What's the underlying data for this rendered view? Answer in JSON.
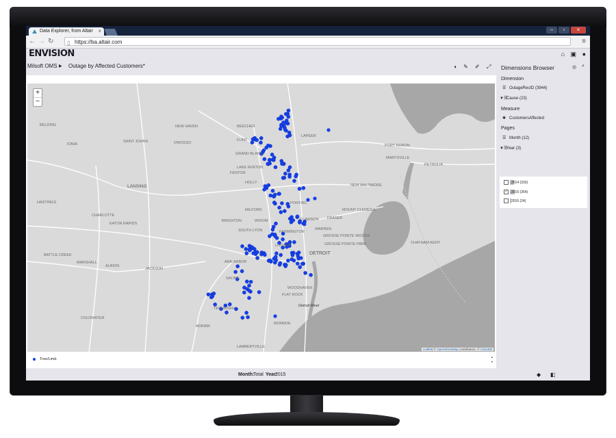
{
  "browser": {
    "tab_title": "Data Explorer, from Altair",
    "url": "https://ba.altair.com"
  },
  "app": {
    "logo": "ENVISION",
    "breadcrumb": [
      "Milsoft OMS",
      "Outage by Affected Customers*"
    ]
  },
  "map": {
    "zoom_in": "+",
    "zoom_out": "−",
    "attribution_leaflet": "Leaflet",
    "attribution_osm": "OpenStreetMap",
    "attribution_mid": "| © ",
    "attribution_contrib": " contributors, © ",
    "attribution_carto": "CartoDB",
    "labels": [
      {
        "id": "belding",
        "text": "BELDING"
      },
      {
        "id": "saint-johns",
        "text": "SAINT JOHNS"
      },
      {
        "id": "owosso",
        "text": "OWOSSO"
      },
      {
        "id": "new-haven",
        "text": "NEW HAVEN"
      },
      {
        "id": "beecher",
        "text": "BEECHER"
      },
      {
        "id": "flint",
        "text": "FLINT"
      },
      {
        "id": "grand-blanc",
        "text": "GRAND BLANC"
      },
      {
        "id": "fenton",
        "text": "FENTON"
      },
      {
        "id": "lake-fenton",
        "text": "LAKE FENTON"
      },
      {
        "id": "holly",
        "text": "HOLLY"
      },
      {
        "id": "ionia",
        "text": "IONIA"
      },
      {
        "id": "lansing",
        "text": "LANSING"
      },
      {
        "id": "hastings",
        "text": "HASTINGS"
      },
      {
        "id": "charlotte",
        "text": "CHARLOTTE"
      },
      {
        "id": "eaton-rapids",
        "text": "EATON RAPIDS"
      },
      {
        "id": "brighton",
        "text": "BRIGHTON"
      },
      {
        "id": "wixom",
        "text": "WIXOM"
      },
      {
        "id": "milford",
        "text": "MILFORD"
      },
      {
        "id": "pontiac",
        "text": "PONTIAC"
      },
      {
        "id": "clawson",
        "text": "CLAWSON"
      },
      {
        "id": "fraser",
        "text": "FRASER"
      },
      {
        "id": "mount-clemens",
        "text": "MOUNT CLEMENS"
      },
      {
        "id": "warren",
        "text": "WARREN"
      },
      {
        "id": "grosse-pointe-woods",
        "text": "GROSSE POINTE WOODS"
      },
      {
        "id": "grosse-pointe-park",
        "text": "GROSSE POINTE PARK"
      },
      {
        "id": "south-lyon",
        "text": "SOUTH LYON"
      },
      {
        "id": "farmington",
        "text": "FARMINGTON"
      },
      {
        "id": "livonia",
        "text": "LIVONIA"
      },
      {
        "id": "detroit",
        "text": "DETROIT"
      },
      {
        "id": "battle-creek",
        "text": "BATTLE CREEK"
      },
      {
        "id": "marshall",
        "text": "MARSHALL"
      },
      {
        "id": "jackson",
        "text": "JACKSON"
      },
      {
        "id": "albion",
        "text": "ALBION"
      },
      {
        "id": "ann-arbor",
        "text": "ANN ARBOR"
      },
      {
        "id": "saline",
        "text": "SALINE"
      },
      {
        "id": "woodhaven",
        "text": "WOODHAVEN"
      },
      {
        "id": "flat-rock",
        "text": "FLAT ROCK"
      },
      {
        "id": "detroit-river",
        "text": "Detroit River"
      },
      {
        "id": "tecumseh",
        "text": "TECUMSEH"
      },
      {
        "id": "adrian",
        "text": "ADRIAN"
      },
      {
        "id": "coldwater",
        "text": "COLDWATER"
      },
      {
        "id": "monroe",
        "text": "MONROE"
      },
      {
        "id": "lambertville",
        "text": "LAMBERTVILLE"
      },
      {
        "id": "port-huron",
        "text": "PORT HURON"
      },
      {
        "id": "marysville",
        "text": "MARYSVILLE"
      },
      {
        "id": "petrolia",
        "text": "PETROLIA"
      },
      {
        "id": "new-baltimore",
        "text": "NEW BALTIMORE"
      },
      {
        "id": "chatham-kent",
        "text": "CHATHAM-KENT"
      },
      {
        "id": "lapeer",
        "text": "LAPEER"
      }
    ]
  },
  "legend": {
    "item": "Tree/Limb",
    "color": "#1540e8"
  },
  "status": {
    "month_label": "Month:",
    "month_value": "Total",
    "year_label": "Year:",
    "year_value": "2015"
  },
  "dimensions": {
    "title": "Dimensions Browser",
    "dimension_label": "Dimension",
    "dimension_items": [
      {
        "label": "OutageRecID",
        "count": "(3944)"
      },
      {
        "label": "Cause",
        "count": "(23)"
      }
    ],
    "measure_label": "Measure",
    "measure_item": "CustomersAffected",
    "pages_label": "Pages",
    "pages_items": [
      {
        "label": "Month",
        "count": "(12)"
      },
      {
        "label": "Year",
        "count": "(3)"
      }
    ],
    "years": [
      {
        "label": "2014",
        "count": "(333)",
        "checked": false,
        "share": 0.08
      },
      {
        "label": "2015",
        "count": "(354)",
        "checked": true,
        "share": 0.09
      },
      {
        "label": "2016",
        "count": "(24)",
        "checked": false,
        "share": 0.01
      }
    ]
  },
  "icons": {
    "home": "home-icon",
    "save": "save-icon",
    "user": "user-icon",
    "theme": "contrast-icon",
    "edit": "pencil-icon",
    "pin": "pin-icon",
    "expand": "expand-icon"
  }
}
